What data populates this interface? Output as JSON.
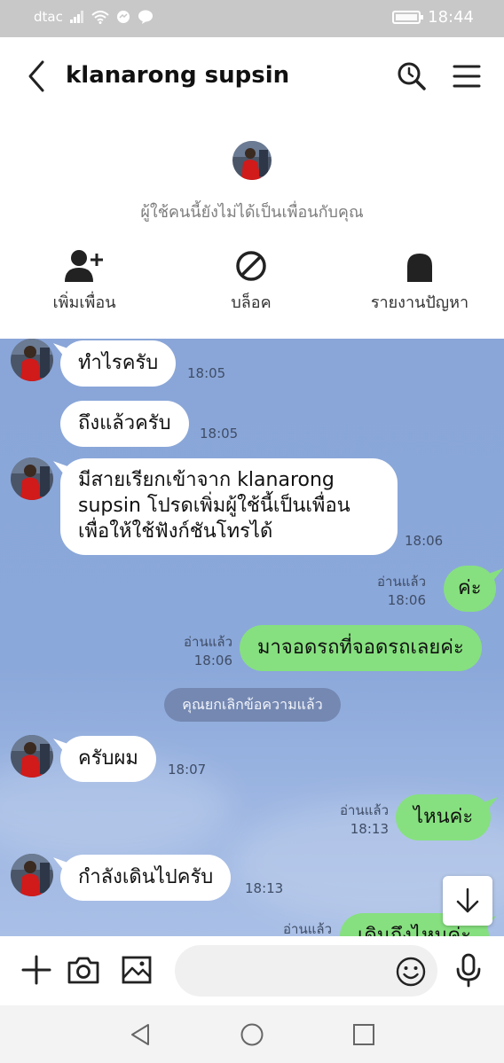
{
  "status_bar": {
    "carrier": "dtac",
    "time": "18:44"
  },
  "header": {
    "title": "klanarong supsin"
  },
  "profile": {
    "note": "ผู้ใช้คนนี้ยังไม่ได้เป็นเพื่อนกับคุณ",
    "actions": [
      {
        "label": "เพิ่มเพื่อน",
        "icon": "add-friend-icon"
      },
      {
        "label": "บล็อค",
        "icon": "block-icon"
      },
      {
        "label": "รายงานปัญหา",
        "icon": "report-icon"
      }
    ]
  },
  "messages": [
    {
      "side": "in",
      "text": "ทำไรครับ",
      "time": "18:05"
    },
    {
      "side": "in",
      "text": "ถึงแล้วครับ",
      "time": "18:05"
    },
    {
      "side": "in",
      "lines": [
        "มีสายเรียกเข้าจาก klanarong",
        "supsin โปรดเพิ่มผู้ใช้นี้เป็นเพื่อน",
        "เพื่อให้ใช้ฟังก์ชันโทรได้"
      ],
      "time": "18:06"
    },
    {
      "side": "out",
      "text": "ค่ะ",
      "read": "อ่านแล้ว",
      "time": "18:06"
    },
    {
      "side": "out",
      "text": "มาจอดรถที่จอดรถเลยค่ะ",
      "read": "อ่านแล้ว",
      "time": "18:06"
    },
    {
      "side": "system",
      "text": "คุณยกเลิกข้อความแล้ว"
    },
    {
      "side": "in",
      "text": "ครับผม",
      "time": "18:07"
    },
    {
      "side": "out",
      "text": "ไหนค่ะ",
      "read": "อ่านแล้ว",
      "time": "18:13"
    },
    {
      "side": "in",
      "text": "กำลังเดินไปครับ",
      "time": "18:13"
    },
    {
      "side": "out",
      "text": "เดินถึงไหนค่ะ",
      "read": "อ่านแล้ว",
      "time": ""
    }
  ],
  "input": {
    "placeholder": ""
  },
  "colors": {
    "chat_bg": "#8aa6d8",
    "outgoing_bubble": "#86e07f",
    "incoming_bubble": "#ffffff",
    "system_note": "#7488b2"
  }
}
